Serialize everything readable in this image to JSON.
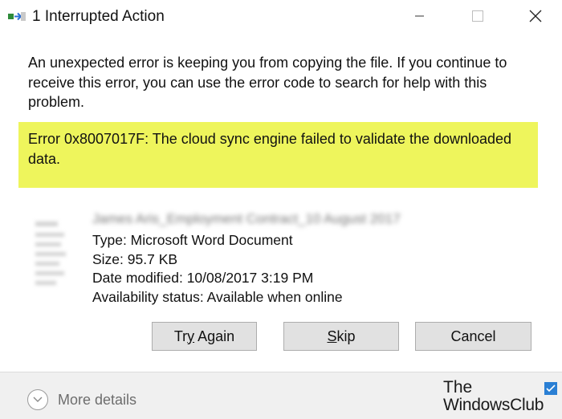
{
  "window": {
    "title": "1 Interrupted Action",
    "icon": "copy-transfer-icon",
    "controls": [
      "minimize-icon",
      "maximize-icon",
      "close-icon"
    ]
  },
  "message": "An unexpected error is keeping you from copying the file. If you continue to receive this error, you can use the error code to search for help with this problem.",
  "error": {
    "text": "Error 0x8007017F: The cloud sync engine failed to validate the downloaded data.",
    "highlight_color": "#eef55c"
  },
  "file": {
    "name": "James Aris_Employment Contract_10 August 2017",
    "type_line": "Type: Microsoft Word Document",
    "size_line": "Size: 95.7 KB",
    "modified_line": "Date modified: 10/08/2017 3:19 PM",
    "availability_line": "Availability status: Available when online"
  },
  "buttons": {
    "try_again_prefix": "Tr",
    "try_again_key": "y",
    "try_again_suffix": " Again",
    "skip_key": "S",
    "skip_suffix": "kip",
    "cancel": "Cancel"
  },
  "footer": {
    "more_details": "More details"
  },
  "watermark": {
    "line1": "The",
    "line2": "WindowsClub"
  }
}
